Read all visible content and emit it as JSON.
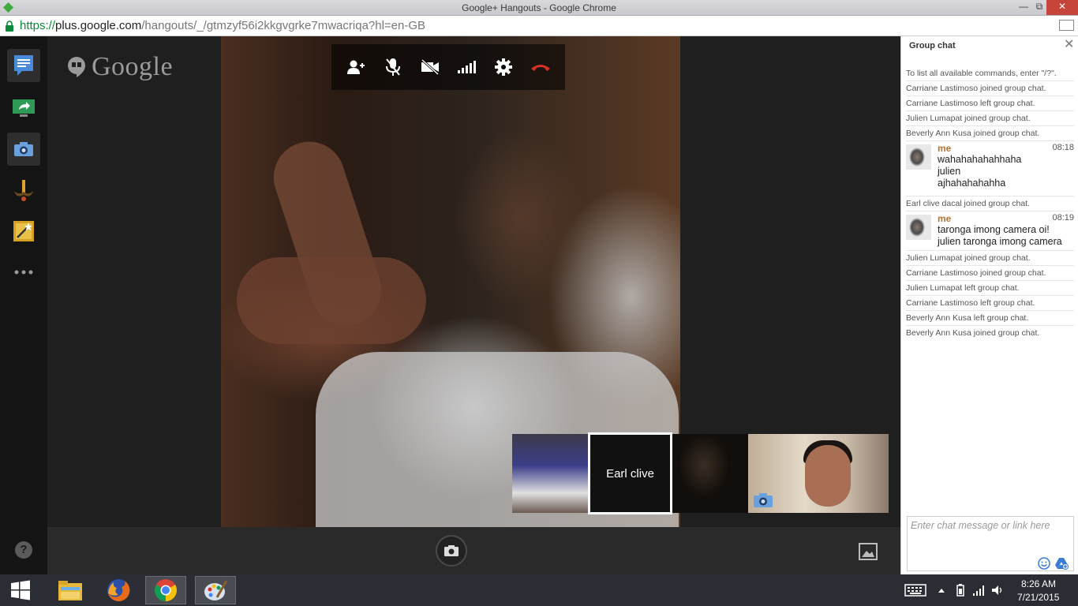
{
  "window": {
    "title": "Google+ Hangouts - Google Chrome",
    "controls": {
      "minimize": "—",
      "maximize": "⧉",
      "close": "✕"
    }
  },
  "address_bar": {
    "url_scheme": "https://",
    "url_host": "plus.google.com",
    "url_path": "/hangouts/_/gtmzyf56i2kkgvgrke7mwacriqa?hl=en-GB"
  },
  "rail": {
    "items": [
      {
        "name": "chat-app",
        "icon": "chat-icon",
        "active": true
      },
      {
        "name": "screenshare-app",
        "icon": "screenshare-icon",
        "active": false
      },
      {
        "name": "capture-app",
        "icon": "camera-icon",
        "active": true
      },
      {
        "name": "effects-app",
        "icon": "mustache-icon",
        "active": false
      },
      {
        "name": "studio-app",
        "icon": "magic-wand-icon",
        "active": false
      },
      {
        "name": "more-apps",
        "icon": "more-icon",
        "active": false
      }
    ],
    "help_label": "?"
  },
  "brand": {
    "word": "Google"
  },
  "toolbar": {
    "buttons": [
      "invite-people-icon",
      "mute-mic-icon",
      "turn-off-camera-icon",
      "bandwidth-icon",
      "settings-icon",
      "hang-up-icon"
    ]
  },
  "filmstrip": {
    "participants": [
      {
        "name": "",
        "icon": ""
      },
      {
        "name": "Earl clive",
        "icon": ""
      },
      {
        "name": "",
        "icon": ""
      },
      {
        "name": "",
        "icon": "camera-icon"
      }
    ]
  },
  "bottom_bar": {
    "snap_icon": "camera-icon",
    "media_icon": "image-icon"
  },
  "chat": {
    "title": "Group chat",
    "close_label": "✕",
    "system_top": [
      "To list all available commands, enter \"/?\".",
      "Carriane Lastimoso joined group chat.",
      "Carriane Lastimoso left group chat.",
      "Julien Lumapat joined group chat.",
      "Beverly Ann Kusa joined group chat."
    ],
    "message1": {
      "author": "me",
      "time": "08:18",
      "lines": [
        "wahahahahahhaha",
        "julien",
        "ajhahahahahha"
      ]
    },
    "system_mid": "Earl clive dacal joined group chat.",
    "message2": {
      "author": "me",
      "time": "08:19",
      "lines": [
        "taronga imong camera oi!",
        "julien taronga imong camera"
      ]
    },
    "system_bottom": [
      "Julien Lumapat joined group chat.",
      "Carriane Lastimoso joined group chat.",
      "Julien Lumapat left group chat.",
      "Carriane Lastimoso left group chat.",
      "Beverly Ann Kusa left group chat.",
      "Beverly Ann Kusa joined group chat."
    ],
    "input_placeholder": "Enter chat message or link here",
    "input_value": ""
  },
  "taskbar": {
    "apps": [
      "windows-start-icon",
      "file-explorer-icon",
      "firefox-icon",
      "chrome-icon",
      "paint-icon"
    ],
    "active_app": "chrome-icon",
    "clock_time": "8:26 AM",
    "clock_date": "7/21/2015"
  },
  "colors": {
    "accent_green": "#0a8a3a",
    "hangup_red": "#d93025",
    "chat_author": "#b87335",
    "rail_bg": "#141414",
    "stage_bg": "#1f1f1f"
  }
}
